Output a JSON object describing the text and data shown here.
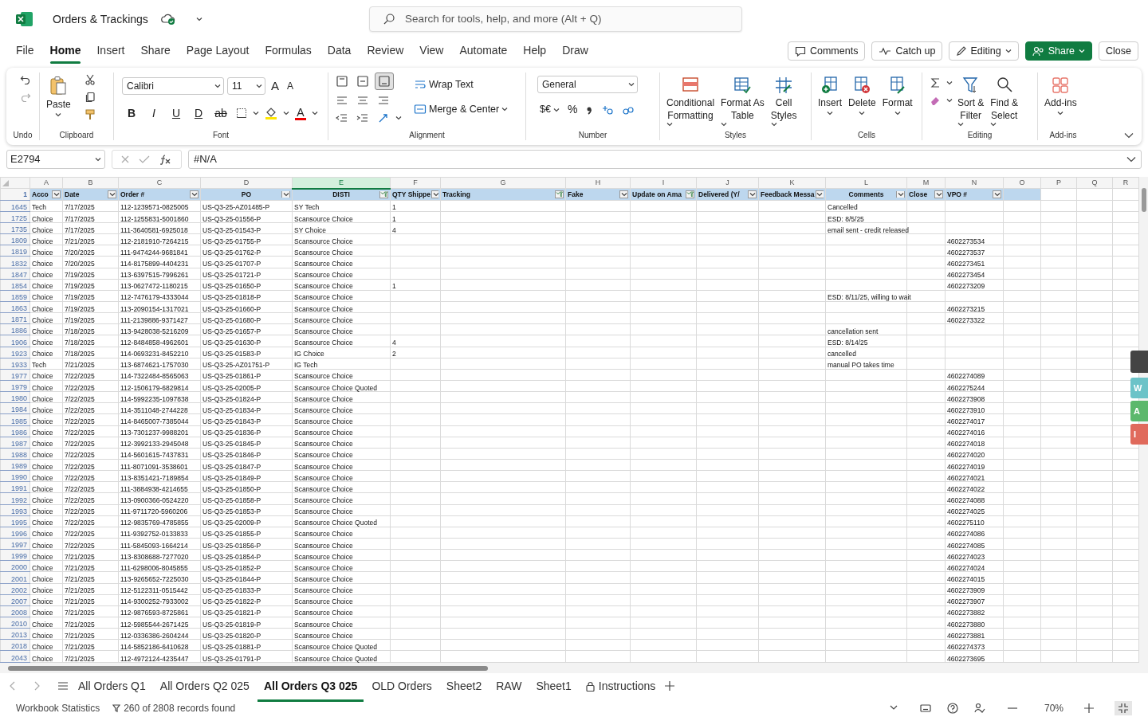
{
  "app": {
    "title": "Orders & Trackings",
    "search_placeholder": "Search for tools, help, and more (Alt + Q)"
  },
  "menu": [
    {
      "label": "File",
      "selected": false
    },
    {
      "label": "Home",
      "selected": true
    },
    {
      "label": "Insert",
      "selected": false
    },
    {
      "label": "Share",
      "selected": false
    },
    {
      "label": "Page Layout",
      "selected": false
    },
    {
      "label": "Formulas",
      "selected": false
    },
    {
      "label": "Data",
      "selected": false
    },
    {
      "label": "Review",
      "selected": false
    },
    {
      "label": "View",
      "selected": false
    },
    {
      "label": "Automate",
      "selected": false
    },
    {
      "label": "Help",
      "selected": false
    },
    {
      "label": "Draw",
      "selected": false
    }
  ],
  "actions": [
    {
      "label": "Comments",
      "kind": "comments"
    },
    {
      "label": "Catch up",
      "kind": "catchup"
    },
    {
      "label": "Editing",
      "kind": "editing"
    },
    {
      "label": "Share",
      "kind": "share"
    },
    {
      "label": "Close",
      "kind": "close"
    }
  ],
  "ribbon": {
    "groups": [
      "Undo",
      "Clipboard",
      "Font",
      "Alignment",
      "Number",
      "Styles",
      "Cells",
      "Editing",
      "Add-ins"
    ],
    "paste": "Paste",
    "font_name": "Calibri",
    "font_size": "11",
    "size_buttons": [
      "A",
      "A"
    ],
    "format_buttons": [
      "B",
      "I",
      "U",
      "D",
      "ab"
    ],
    "font_color": "A",
    "wrap_text": "Wrap Text",
    "merge": "Merge & Center",
    "number_format": "General",
    "currency": "$€",
    "percent": "%",
    "styles": [
      {
        "lines": [
          "Conditional",
          "Formatting"
        ],
        "kind": "conditional"
      },
      {
        "lines": [
          "Format As",
          "Table"
        ],
        "kind": "table"
      },
      {
        "lines": [
          "Cell",
          "Styles"
        ],
        "kind": "cellstyles"
      }
    ],
    "cells": [
      {
        "label": "Insert",
        "kind": "insert"
      },
      {
        "label": "Delete",
        "kind": "delete"
      },
      {
        "label": "Format",
        "kind": "format"
      }
    ],
    "editing": [
      {
        "lines": [
          "Sort &",
          "Filter"
        ],
        "kind": "sort"
      },
      {
        "lines": [
          "Find &",
          "Select"
        ],
        "kind": "find"
      }
    ],
    "addins": "Add-ins"
  },
  "formula_bar": {
    "name_box": "E2794",
    "formula": "#N/A"
  },
  "columns": [
    {
      "letter": "A",
      "selected": false
    },
    {
      "letter": "B",
      "selected": false
    },
    {
      "letter": "C",
      "selected": false
    },
    {
      "letter": "D",
      "selected": false
    },
    {
      "letter": "E",
      "selected": true
    },
    {
      "letter": "F",
      "selected": false
    },
    {
      "letter": "G",
      "selected": false
    },
    {
      "letter": "H",
      "selected": false
    },
    {
      "letter": "I",
      "selected": false
    },
    {
      "letter": "J",
      "selected": false
    },
    {
      "letter": "K",
      "selected": false
    },
    {
      "letter": "L",
      "selected": false
    },
    {
      "letter": "M",
      "selected": false
    },
    {
      "letter": "N",
      "selected": false
    },
    {
      "letter": "O",
      "selected": false
    },
    {
      "letter": "P",
      "selected": false
    },
    {
      "letter": "Q",
      "selected": false
    },
    {
      "letter": "R",
      "selected": false
    }
  ],
  "header_row": "1",
  "headers": [
    {
      "label": "Acco",
      "filtered": false
    },
    {
      "label": "Date",
      "filtered": false
    },
    {
      "label": "Order #",
      "filtered": false
    },
    {
      "label": "PO",
      "filtered": false
    },
    {
      "label": "DISTI",
      "filtered": true
    },
    {
      "label": "QTY Shippe",
      "filtered": false
    },
    {
      "label": "Tracking",
      "filtered": true
    },
    {
      "label": "Fake",
      "filtered": false
    },
    {
      "label": "Update on Ama",
      "filtered": true
    },
    {
      "label": "Delivered (Y/",
      "filtered": false
    },
    {
      "label": "Feedback Messa",
      "filtered": false
    },
    {
      "label": "Comments",
      "filtered": false
    },
    {
      "label": "Close",
      "filtered": false
    },
    {
      "label": "VPO #",
      "filtered": false
    }
  ],
  "rows": [
    {
      "row": "1645",
      "account": "Tech",
      "date": "7/17/2025",
      "order": "112-1239571-0825005",
      "po": "US-Q3-25-AZ01485-P",
      "disti": "SY Tech",
      "qty": "1",
      "comments": "Cancelled"
    },
    {
      "row": "1725",
      "account": "Choice",
      "date": "7/17/2025",
      "order": "112-1255831-5001860",
      "po": "US-Q3-25-01556-P",
      "disti": "Scansource Choice",
      "qty": "1",
      "comments": "ESD: 8/5/25"
    },
    {
      "row": "1735",
      "account": "Choice",
      "date": "7/17/2025",
      "order": "111-3640581-6925018",
      "po": "US-Q3-25-01543-P",
      "disti": "SY Choice",
      "qty": "4",
      "comments": "email sent - credit released"
    },
    {
      "row": "1809",
      "account": "Choice",
      "date": "7/21/2025",
      "order": "112-2181910-7264215",
      "po": "US-Q3-25-01755-P",
      "disti": "Scansource Choice",
      "vpo": "4602273534"
    },
    {
      "row": "1819",
      "account": "Choice",
      "date": "7/20/2025",
      "order": "111-9474244-9681841",
      "po": "US-Q3-25-01762-P",
      "disti": "Scansource Choice",
      "vpo": "4602273537"
    },
    {
      "row": "1832",
      "account": "Choice",
      "date": "7/20/2025",
      "order": "114-8175899-4404231",
      "po": "US-Q3-25-01707-P",
      "disti": "Scansource Choice",
      "vpo": "4602273451"
    },
    {
      "row": "1847",
      "account": "Choice",
      "date": "7/19/2025",
      "order": "113-6397515-7996261",
      "po": "US-Q3-25-01721-P",
      "disti": "Scansource Choice",
      "vpo": "4602273454"
    },
    {
      "row": "1854",
      "account": "Choice",
      "date": "7/19/2025",
      "order": "113-0627472-1180215",
      "po": "US-Q3-25-01650-P",
      "disti": "Scansource Choice",
      "qty": "1",
      "vpo": "4602273209"
    },
    {
      "row": "1859",
      "account": "Choice",
      "date": "7/19/2025",
      "order": "112-7476179-4333044",
      "po": "US-Q3-25-01818-P",
      "disti": "Scansource Choice",
      "comments": "ESD: 8/11/25, willing to wait"
    },
    {
      "row": "1863",
      "account": "Choice",
      "date": "7/19/2025",
      "order": "113-2090154-1317021",
      "po": "US-Q3-25-01660-P",
      "disti": "Scansource Choice",
      "vpo": "4602273215"
    },
    {
      "row": "1871",
      "account": "Choice",
      "date": "7/19/2025",
      "order": "111-2139886-9371427",
      "po": "US-Q3-25-01680-P",
      "disti": "Scansource Choice",
      "vpo": "4602273322"
    },
    {
      "row": "1886",
      "account": "Choice",
      "date": "7/18/2025",
      "order": "113-9428038-5216209",
      "po": "US-Q3-25-01657-P",
      "disti": "Scansource Choice",
      "comments": "cancellation sent"
    },
    {
      "row": "1906",
      "account": "Choice",
      "date": "7/18/2025",
      "order": "112-8484858-4962601",
      "po": "US-Q3-25-01630-P",
      "disti": "Scansource Choice",
      "qty": "4",
      "comments": "ESD: 8/14/25"
    },
    {
      "row": "1923",
      "account": "Choice",
      "date": "7/18/2025",
      "order": "114-0693231-8452210",
      "po": "US-Q3-25-01583-P",
      "disti": "IG Choice",
      "qty": "2",
      "comments": "cancelled"
    },
    {
      "row": "1933",
      "account": "Tech",
      "date": "7/21/2025",
      "order": "113-6874621-1757030",
      "po": "US-Q3-25-AZ01751-P",
      "disti": "IG Tech",
      "comments": "manual PO takes time"
    },
    {
      "row": "1977",
      "account": "Choice",
      "date": "7/22/2025",
      "order": "114-7322484-8565063",
      "po": "US-Q3-25-01861-P",
      "disti": "Scansource Choice",
      "vpo": "4602274089"
    },
    {
      "row": "1979",
      "account": "Choice",
      "date": "7/22/2025",
      "order": "112-1506179-6829814",
      "po": "US-Q3-25-02005-P",
      "disti": "Scansource Choice Quoted",
      "vpo": "4602275244"
    },
    {
      "row": "1980",
      "account": "Choice",
      "date": "7/22/2025",
      "order": "114-5992235-1097838",
      "po": "US-Q3-25-01824-P",
      "disti": "Scansource Choice",
      "vpo": "4602273908"
    },
    {
      "row": "1984",
      "account": "Choice",
      "date": "7/22/2025",
      "order": "114-3511048-2744228",
      "po": "US-Q3-25-01834-P",
      "disti": "Scansource Choice",
      "vpo": "4602273910"
    },
    {
      "row": "1985",
      "account": "Choice",
      "date": "7/22/2025",
      "order": "114-8465007-7385044",
      "po": "US-Q3-25-01843-P",
      "disti": "Scansource Choice",
      "vpo": "4602274017"
    },
    {
      "row": "1986",
      "account": "Choice",
      "date": "7/22/2025",
      "order": "113-7301237-9988201",
      "po": "US-Q3-25-01836-P",
      "disti": "Scansource Choice",
      "vpo": "4602274016"
    },
    {
      "row": "1987",
      "account": "Choice",
      "date": "7/22/2025",
      "order": "112-3992133-2945048",
      "po": "US-Q3-25-01845-P",
      "disti": "Scansource Choice",
      "vpo": "4602274018"
    },
    {
      "row": "1988",
      "account": "Choice",
      "date": "7/22/2025",
      "order": "114-5601615-7437831",
      "po": "US-Q3-25-01846-P",
      "disti": "Scansource Choice",
      "vpo": "4602274020"
    },
    {
      "row": "1989",
      "account": "Choice",
      "date": "7/22/2025",
      "order": "111-8071091-3538601",
      "po": "US-Q3-25-01847-P",
      "disti": "Scansource Choice",
      "vpo": "4602274019"
    },
    {
      "row": "1990",
      "account": "Choice",
      "date": "7/22/2025",
      "order": "113-8351421-7189854",
      "po": "US-Q3-25-01849-P",
      "disti": "Scansource Choice",
      "vpo": "4602274021"
    },
    {
      "row": "1991",
      "account": "Choice",
      "date": "7/22/2025",
      "order": "111-3884938-4214655",
      "po": "US-Q3-25-01850-P",
      "disti": "Scansource Choice",
      "vpo": "4602274022"
    },
    {
      "row": "1992",
      "account": "Choice",
      "date": "7/22/2025",
      "order": "113-0900366-0524220",
      "po": "US-Q3-25-01858-P",
      "disti": "Scansource Choice",
      "vpo": "4602274088"
    },
    {
      "row": "1993",
      "account": "Choice",
      "date": "7/22/2025",
      "order": "111-9711720-5960206",
      "po": "US-Q3-25-01853-P",
      "disti": "Scansource Choice",
      "vpo": "4602274025"
    },
    {
      "row": "1995",
      "account": "Choice",
      "date": "7/22/2025",
      "order": "112-9835769-4785855",
      "po": "US-Q3-25-02009-P",
      "disti": "Scansource Choice Quoted",
      "vpo": "4602275110"
    },
    {
      "row": "1996",
      "account": "Choice",
      "date": "7/22/2025",
      "order": "111-9392752-0133833",
      "po": "US-Q3-25-01855-P",
      "disti": "Scansource Choice",
      "vpo": "4602274086"
    },
    {
      "row": "1997",
      "account": "Choice",
      "date": "7/22/2025",
      "order": "111-5845093-1664214",
      "po": "US-Q3-25-01856-P",
      "disti": "Scansource Choice",
      "vpo": "4602274085"
    },
    {
      "row": "1999",
      "account": "Choice",
      "date": "7/21/2025",
      "order": "113-8308688-7277020",
      "po": "US-Q3-25-01854-P",
      "disti": "Scansource Choice",
      "vpo": "4602274023"
    },
    {
      "row": "2000",
      "account": "Choice",
      "date": "7/21/2025",
      "order": "111-6298006-8045855",
      "po": "US-Q3-25-01852-P",
      "disti": "Scansource Choice",
      "vpo": "4602274024"
    },
    {
      "row": "2001",
      "account": "Choice",
      "date": "7/21/2025",
      "order": "113-9265652-7225030",
      "po": "US-Q3-25-01844-P",
      "disti": "Scansource Choice",
      "vpo": "4602274015"
    },
    {
      "row": "2002",
      "account": "Choice",
      "date": "7/21/2025",
      "order": "112-5122311-0515442",
      "po": "US-Q3-25-01833-P",
      "disti": "Scansource Choice",
      "vpo": "4602273909"
    },
    {
      "row": "2007",
      "account": "Choice",
      "date": "7/21/2025",
      "order": "114-9300252-7933002",
      "po": "US-Q3-25-01822-P",
      "disti": "Scansource Choice",
      "vpo": "4602273907"
    },
    {
      "row": "2008",
      "account": "Choice",
      "date": "7/21/2025",
      "order": "112-9876593-8725861",
      "po": "US-Q3-25-01821-P",
      "disti": "Scansource Choice",
      "vpo": "4602273882"
    },
    {
      "row": "2010",
      "account": "Choice",
      "date": "7/21/2025",
      "order": "112-5985544-2671425",
      "po": "US-Q3-25-01819-P",
      "disti": "Scansource Choice",
      "vpo": "4602273880"
    },
    {
      "row": "2013",
      "account": "Choice",
      "date": "7/21/2025",
      "order": "112-0336386-2604244",
      "po": "US-Q3-25-01820-P",
      "disti": "Scansource Choice",
      "vpo": "4602273881"
    },
    {
      "row": "2018",
      "account": "Choice",
      "date": "7/21/2025",
      "order": "114-5852186-6410628",
      "po": "US-Q3-25-01881-P",
      "disti": "Scansource Choice Quoted",
      "vpo": "4602274373"
    },
    {
      "row": "2043",
      "account": "Choice",
      "date": "7/21/2025",
      "order": "112-4972124-4235447",
      "po": "US-Q3-25-01791-P",
      "disti": "Scansource Choice Quoted",
      "vpo": "4602273695"
    }
  ],
  "side_panel": [
    {
      "label": "W",
      "color": "#6cc3c8"
    },
    {
      "label": "A",
      "color": "#5cb86c"
    },
    {
      "label": "I",
      "color": "#e06a5c"
    }
  ],
  "sheet_tabs": [
    {
      "label": "All Orders Q1",
      "selected": false,
      "locked": false
    },
    {
      "label": "All Orders Q2 025",
      "selected": false,
      "locked": false
    },
    {
      "label": "All Orders Q3 025",
      "selected": true,
      "locked": false
    },
    {
      "label": "OLD Orders",
      "selected": false,
      "locked": false
    },
    {
      "label": "Sheet2",
      "selected": false,
      "locked": false
    },
    {
      "label": "RAW",
      "selected": false,
      "locked": false
    },
    {
      "label": "Sheet1",
      "selected": false,
      "locked": false
    },
    {
      "label": "Instructions",
      "selected": false,
      "locked": true
    }
  ],
  "status": {
    "left": "Workbook Statistics",
    "records": "260 of 2808 records found",
    "zoom": "70%"
  }
}
